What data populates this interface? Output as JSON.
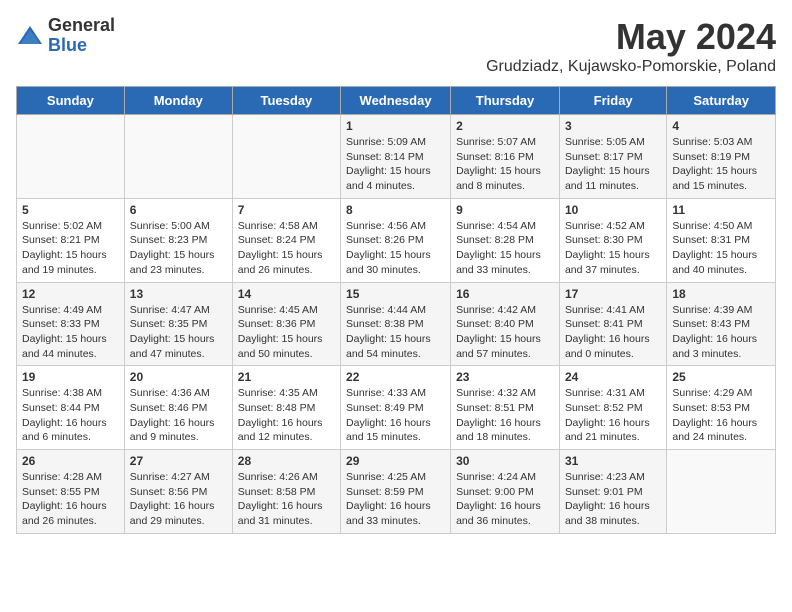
{
  "logo": {
    "general": "General",
    "blue": "Blue"
  },
  "title": "May 2024",
  "location": "Grudziadz, Kujawsko-Pomorskie, Poland",
  "days_of_week": [
    "Sunday",
    "Monday",
    "Tuesday",
    "Wednesday",
    "Thursday",
    "Friday",
    "Saturday"
  ],
  "weeks": [
    [
      {
        "day": "",
        "info": ""
      },
      {
        "day": "",
        "info": ""
      },
      {
        "day": "",
        "info": ""
      },
      {
        "day": "1",
        "info": "Sunrise: 5:09 AM\nSunset: 8:14 PM\nDaylight: 15 hours\nand 4 minutes."
      },
      {
        "day": "2",
        "info": "Sunrise: 5:07 AM\nSunset: 8:16 PM\nDaylight: 15 hours\nand 8 minutes."
      },
      {
        "day": "3",
        "info": "Sunrise: 5:05 AM\nSunset: 8:17 PM\nDaylight: 15 hours\nand 11 minutes."
      },
      {
        "day": "4",
        "info": "Sunrise: 5:03 AM\nSunset: 8:19 PM\nDaylight: 15 hours\nand 15 minutes."
      }
    ],
    [
      {
        "day": "5",
        "info": "Sunrise: 5:02 AM\nSunset: 8:21 PM\nDaylight: 15 hours\nand 19 minutes."
      },
      {
        "day": "6",
        "info": "Sunrise: 5:00 AM\nSunset: 8:23 PM\nDaylight: 15 hours\nand 23 minutes."
      },
      {
        "day": "7",
        "info": "Sunrise: 4:58 AM\nSunset: 8:24 PM\nDaylight: 15 hours\nand 26 minutes."
      },
      {
        "day": "8",
        "info": "Sunrise: 4:56 AM\nSunset: 8:26 PM\nDaylight: 15 hours\nand 30 minutes."
      },
      {
        "day": "9",
        "info": "Sunrise: 4:54 AM\nSunset: 8:28 PM\nDaylight: 15 hours\nand 33 minutes."
      },
      {
        "day": "10",
        "info": "Sunrise: 4:52 AM\nSunset: 8:30 PM\nDaylight: 15 hours\nand 37 minutes."
      },
      {
        "day": "11",
        "info": "Sunrise: 4:50 AM\nSunset: 8:31 PM\nDaylight: 15 hours\nand 40 minutes."
      }
    ],
    [
      {
        "day": "12",
        "info": "Sunrise: 4:49 AM\nSunset: 8:33 PM\nDaylight: 15 hours\nand 44 minutes."
      },
      {
        "day": "13",
        "info": "Sunrise: 4:47 AM\nSunset: 8:35 PM\nDaylight: 15 hours\nand 47 minutes."
      },
      {
        "day": "14",
        "info": "Sunrise: 4:45 AM\nSunset: 8:36 PM\nDaylight: 15 hours\nand 50 minutes."
      },
      {
        "day": "15",
        "info": "Sunrise: 4:44 AM\nSunset: 8:38 PM\nDaylight: 15 hours\nand 54 minutes."
      },
      {
        "day": "16",
        "info": "Sunrise: 4:42 AM\nSunset: 8:40 PM\nDaylight: 15 hours\nand 57 minutes."
      },
      {
        "day": "17",
        "info": "Sunrise: 4:41 AM\nSunset: 8:41 PM\nDaylight: 16 hours\nand 0 minutes."
      },
      {
        "day": "18",
        "info": "Sunrise: 4:39 AM\nSunset: 8:43 PM\nDaylight: 16 hours\nand 3 minutes."
      }
    ],
    [
      {
        "day": "19",
        "info": "Sunrise: 4:38 AM\nSunset: 8:44 PM\nDaylight: 16 hours\nand 6 minutes."
      },
      {
        "day": "20",
        "info": "Sunrise: 4:36 AM\nSunset: 8:46 PM\nDaylight: 16 hours\nand 9 minutes."
      },
      {
        "day": "21",
        "info": "Sunrise: 4:35 AM\nSunset: 8:48 PM\nDaylight: 16 hours\nand 12 minutes."
      },
      {
        "day": "22",
        "info": "Sunrise: 4:33 AM\nSunset: 8:49 PM\nDaylight: 16 hours\nand 15 minutes."
      },
      {
        "day": "23",
        "info": "Sunrise: 4:32 AM\nSunset: 8:51 PM\nDaylight: 16 hours\nand 18 minutes."
      },
      {
        "day": "24",
        "info": "Sunrise: 4:31 AM\nSunset: 8:52 PM\nDaylight: 16 hours\nand 21 minutes."
      },
      {
        "day": "25",
        "info": "Sunrise: 4:29 AM\nSunset: 8:53 PM\nDaylight: 16 hours\nand 24 minutes."
      }
    ],
    [
      {
        "day": "26",
        "info": "Sunrise: 4:28 AM\nSunset: 8:55 PM\nDaylight: 16 hours\nand 26 minutes."
      },
      {
        "day": "27",
        "info": "Sunrise: 4:27 AM\nSunset: 8:56 PM\nDaylight: 16 hours\nand 29 minutes."
      },
      {
        "day": "28",
        "info": "Sunrise: 4:26 AM\nSunset: 8:58 PM\nDaylight: 16 hours\nand 31 minutes."
      },
      {
        "day": "29",
        "info": "Sunrise: 4:25 AM\nSunset: 8:59 PM\nDaylight: 16 hours\nand 33 minutes."
      },
      {
        "day": "30",
        "info": "Sunrise: 4:24 AM\nSunset: 9:00 PM\nDaylight: 16 hours\nand 36 minutes."
      },
      {
        "day": "31",
        "info": "Sunrise: 4:23 AM\nSunset: 9:01 PM\nDaylight: 16 hours\nand 38 minutes."
      },
      {
        "day": "",
        "info": ""
      }
    ]
  ]
}
